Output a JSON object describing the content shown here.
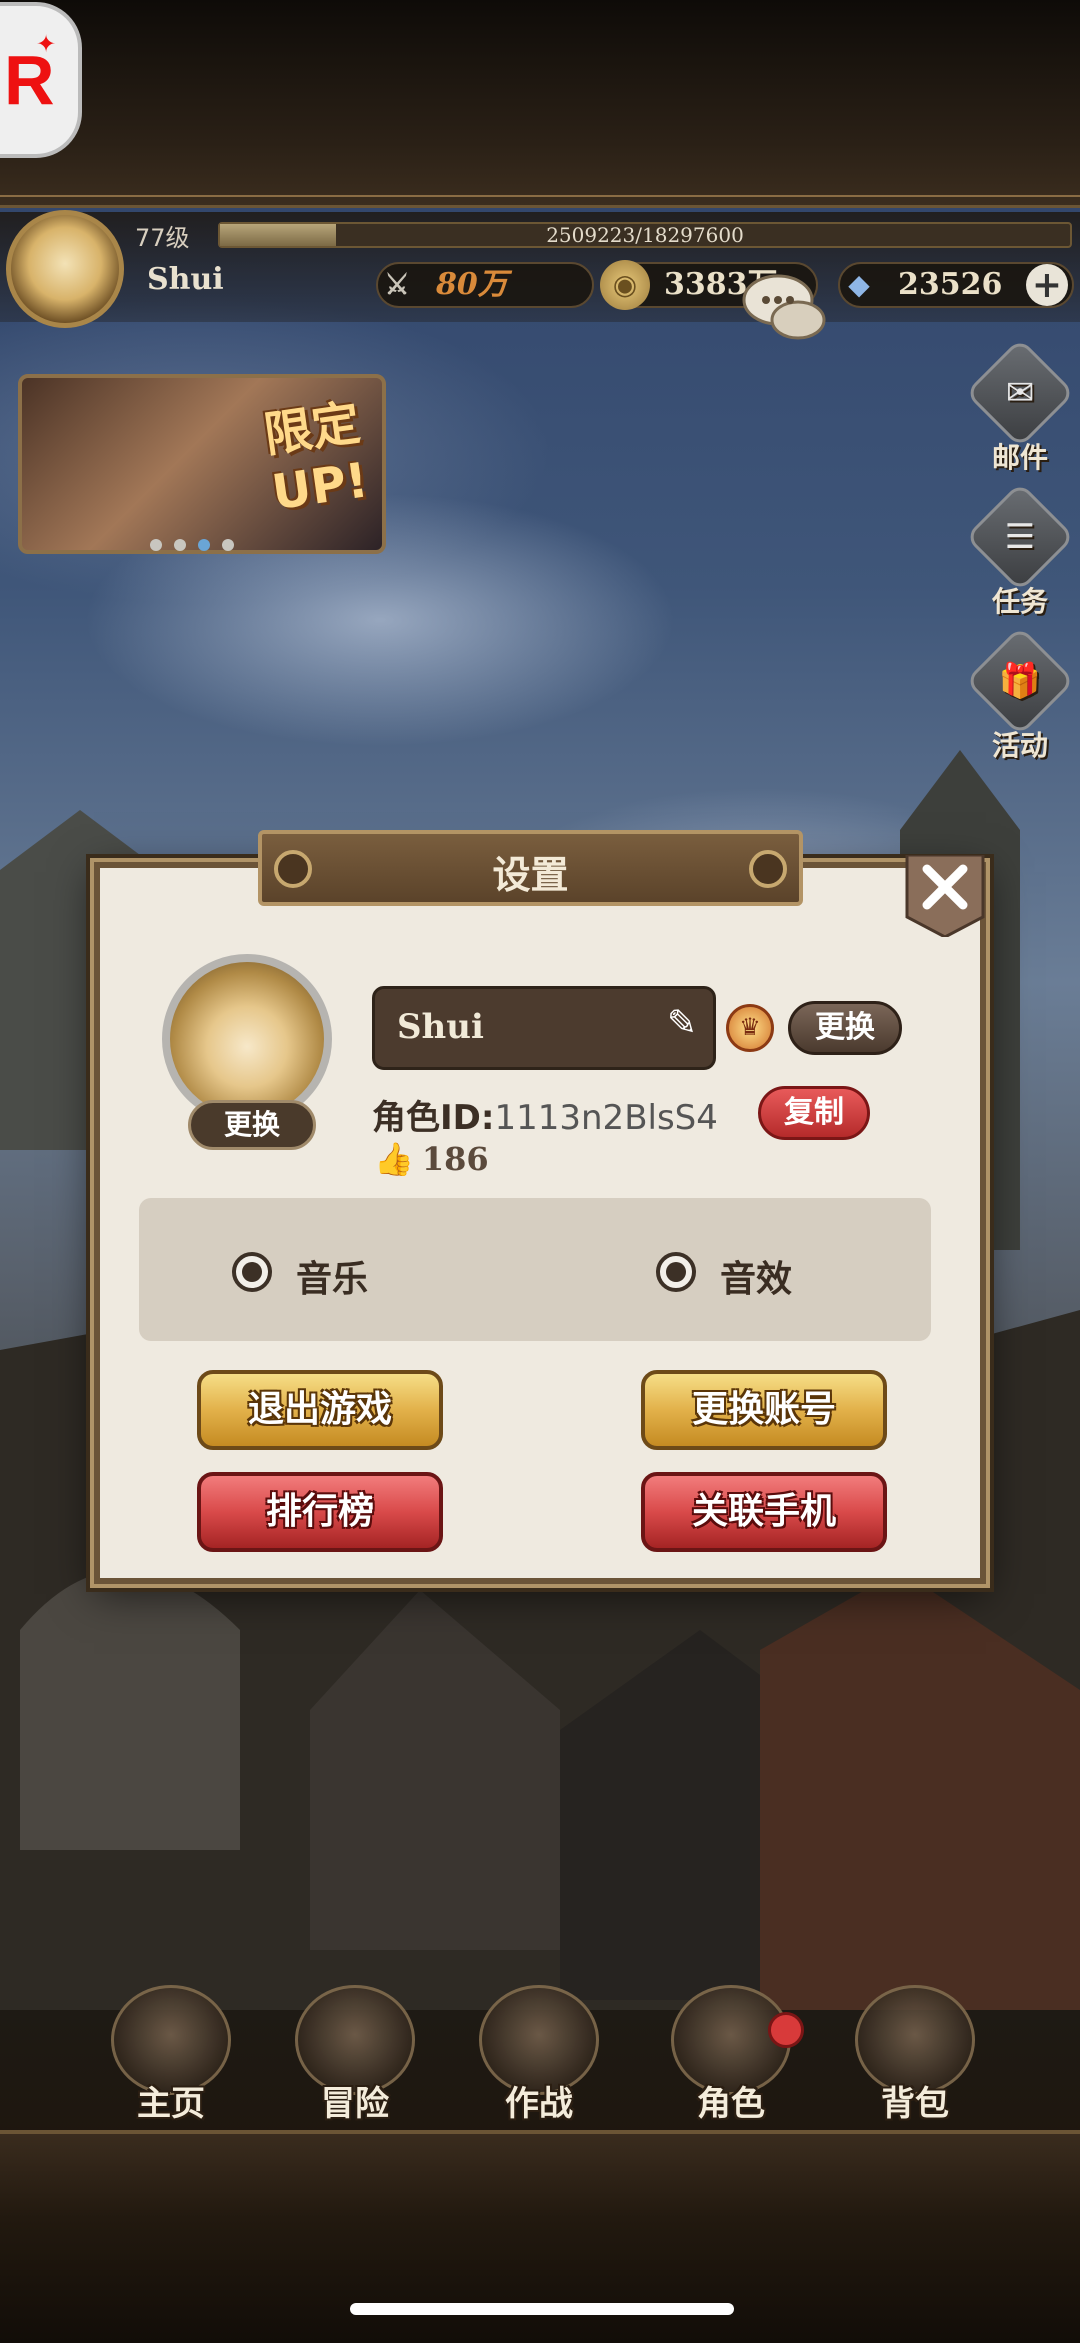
{
  "hud": {
    "level": "77级",
    "xp_text": "2509223/18297600",
    "xp_fraction": 0.137,
    "player_name": "Shui",
    "power": "80万",
    "gold": "3383万",
    "gems": "23526",
    "plus_icon": "plus-icon"
  },
  "banner": {
    "text_line1": "限定",
    "text_line2": "UP!",
    "page_count": 4,
    "active_page": 3
  },
  "side_menu": [
    {
      "label": "邮件",
      "icon": "mail-icon",
      "glyph": "✉"
    },
    {
      "label": "任务",
      "icon": "quest-icon",
      "glyph": "☰"
    },
    {
      "label": "活动",
      "icon": "gift-icon",
      "glyph": "🎁"
    }
  ],
  "dialog": {
    "title": "设置",
    "close_icon": "close-icon",
    "avatar_change_label": "更换",
    "name": "Shui",
    "change_label": "更换",
    "role_id_label": "角色ID:",
    "role_id": "1113n2BlsS4",
    "copy_label": "复制",
    "likes": "186",
    "music_label": "音乐",
    "sfx_label": "音效",
    "exit_label": "退出游戏",
    "switch_account_label": "更换账号",
    "ranking_label": "排行榜",
    "link_phone_label": "关联手机"
  },
  "bottom_nav": [
    {
      "label": "主页",
      "icon": "home-icon"
    },
    {
      "label": "冒险",
      "icon": "adventure-icon"
    },
    {
      "label": "作战",
      "icon": "battle-icon"
    },
    {
      "label": "角色",
      "icon": "character-icon"
    },
    {
      "label": "背包",
      "icon": "bag-icon"
    }
  ],
  "colors": {
    "gold_button": "#e2b14a",
    "red_button": "#d94a4a",
    "panel": "#efeae0",
    "frame": "#6b5438"
  }
}
